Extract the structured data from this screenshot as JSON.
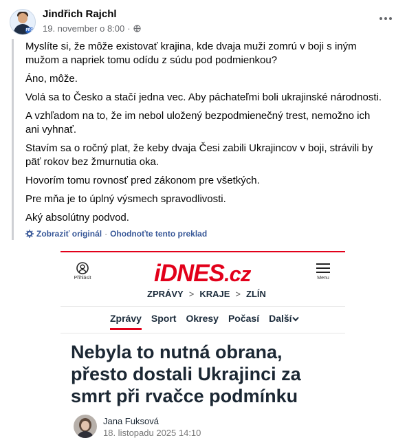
{
  "post": {
    "author": "Jindřich Rajchl",
    "timestamp": "19. november o 8:00",
    "dot": "·",
    "avatar_badge": "PRO",
    "paragraphs": [
      "Myslíte si, že môže existovať krajina, kde dvaja muži zomrú v boji s iným mužom a napriek tomu odídu z súdu pod podmienkou?",
      "Áno, môže.",
      "Volá sa to Česko a stačí jedna vec. Aby páchateľmi boli ukrajinské národnosti.",
      "A vzhľadom na to, že im nebol uložený bezpodmienečný trest, nemožno ich ani vyhnať.",
      "Stavím sa o ročný plat, že keby dvaja Česi zabili Ukrajincov v boji, strávili by päť rokov bez žmurnutia oka.",
      "Hovorím tomu rovnosť pred zákonom pre všetkých.",
      "Pre mňa je to úplný výsmech spravodlivosti.",
      "Aký absolútny podvod."
    ],
    "show_original": "Zobraziť originál",
    "translate_sep": "·",
    "rate_translation": "Ohodnoťte tento preklad"
  },
  "article": {
    "login_label": "Přihlásit",
    "brand_main": "iDNES",
    "brand_tld": ".cz",
    "menu_label": "Menu",
    "breadcrumb": [
      "ZPRÁVY",
      "KRAJE",
      "ZLÍN"
    ],
    "breadcrumb_sep": ">",
    "nav": [
      "Zprávy",
      "Sport",
      "Okresy",
      "Počasí",
      "Další"
    ],
    "headline": "Nebyla to nutná obrana, přesto dostali Ukrajinci za smrt při rvačce podmínku",
    "author": "Jana Fuksová",
    "date": "18. listopadu 2025  14:10"
  },
  "icons": {
    "more": "more-options-icon",
    "globe": "globe-icon",
    "translate": "translate-gear-icon",
    "login": "user-icon",
    "menu": "hamburger-menu-icon",
    "dropdown": "chevron-down-icon"
  },
  "colors": {
    "brand_red": "#e2001a",
    "fb_link": "#385898",
    "meta_gray": "#65676b"
  }
}
